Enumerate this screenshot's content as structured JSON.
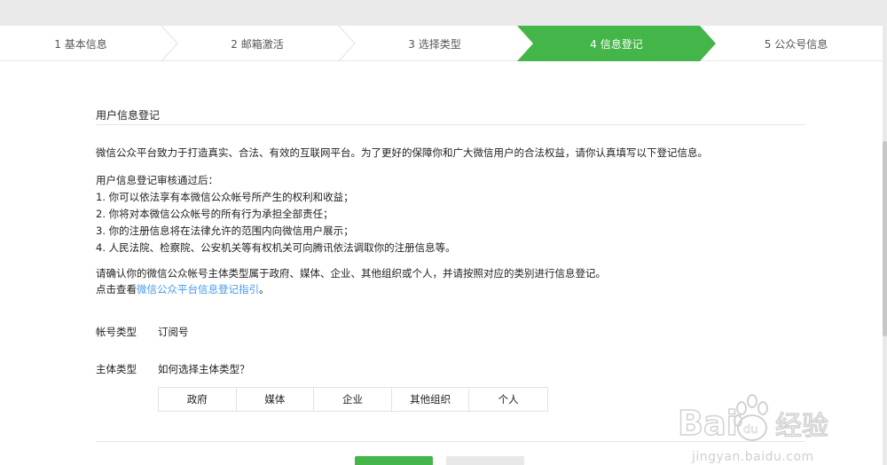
{
  "steps": [
    {
      "label": "1 基本信息",
      "state": "done"
    },
    {
      "label": "2 邮箱激活",
      "state": "done"
    },
    {
      "label": "3 选择类型",
      "state": "done"
    },
    {
      "label": "4 信息登记",
      "state": "active"
    },
    {
      "label": "5 公众号信息",
      "state": "todo"
    }
  ],
  "colors": {
    "accent": "#44b549",
    "link": "#459ae9",
    "divider": "#e5e5e5"
  },
  "section": {
    "title": "用户信息登记"
  },
  "intro": "微信公众平台致力于打造真实、合法、有效的互联网平台。为了更好的保障你和广大微信用户的合法权益，请你认真填写以下登记信息。",
  "review": {
    "heading": "用户信息登记审核通过后：",
    "items": [
      "1. 你可以依法享有本微信公众帐号所产生的权利和收益；",
      "2. 你将对本微信公众帐号的所有行为承担全部责任；",
      "3. 你的注册信息将在法律允许的范围内向微信用户展示；",
      "4. 人民法院、检察院、公安机关等有权机关可向腾讯依法调取你的注册信息等。"
    ]
  },
  "confirm": {
    "line1": "请确认你的微信公众帐号主体类型属于政府、媒体、企业、其他组织或个人，并请按照对应的类别进行信息登记。",
    "line2_prefix": "点击查看",
    "line2_link": "微信公众平台信息登记指引",
    "line2_suffix": "。"
  },
  "account_type": {
    "label": "帐号类型",
    "value": "订阅号"
  },
  "subject_type": {
    "label": "主体类型",
    "help_link": "如何选择主体类型？",
    "options": [
      "政府",
      "媒体",
      "企业",
      "其他组织",
      "个人"
    ]
  },
  "watermark": {
    "logo_text": "Bai du 经验",
    "url": "jingyan.baidu.com"
  }
}
